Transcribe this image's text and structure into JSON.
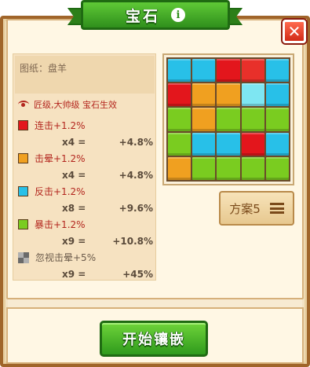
{
  "title": "宝石",
  "title_info_icon": "i",
  "close_icon": "✕",
  "blueprint_label": "图纸：盘羊",
  "rank_text": "匠级,大帅级 宝石生效",
  "stats": [
    {
      "color": "#e3161c",
      "label": "连击+1.2%",
      "count": "x4 =",
      "total": "+4.8%"
    },
    {
      "color": "#f0a020",
      "label": "击晕+1.2%",
      "count": "x4 =",
      "total": "+4.8%"
    },
    {
      "color": "#28c0e8",
      "label": "反击+1.2%",
      "count": "x8 =",
      "total": "+9.6%"
    },
    {
      "color": "#7acc20",
      "label": "暴击+1.2%",
      "count": "x9 =",
      "total": "+10.8%"
    }
  ],
  "ignore_stat": {
    "label": "忽视击晕+5%",
    "count": "x9 =",
    "total": "+45%"
  },
  "board": [
    [
      "#28c0e8",
      "#28c0e8",
      "#e3161c",
      "#e8302a",
      "#28c0e8"
    ],
    [
      "#e3161c",
      "#f0a020",
      "#f0a020",
      "#7ee6f2",
      "#28c0e8"
    ],
    [
      "#7acc20",
      "#f0a020",
      "#7acc20",
      "#7acc20",
      "#7acc20"
    ],
    [
      "#7acc20",
      "#28c0e8",
      "#28c0e8",
      "#e3161c",
      "#28c0e8"
    ],
    [
      "#f0a020",
      "#7acc20",
      "#7acc20",
      "#7acc20",
      "#7acc20"
    ]
  ],
  "scheme_label": "方案5",
  "start_label": "开始镶嵌"
}
